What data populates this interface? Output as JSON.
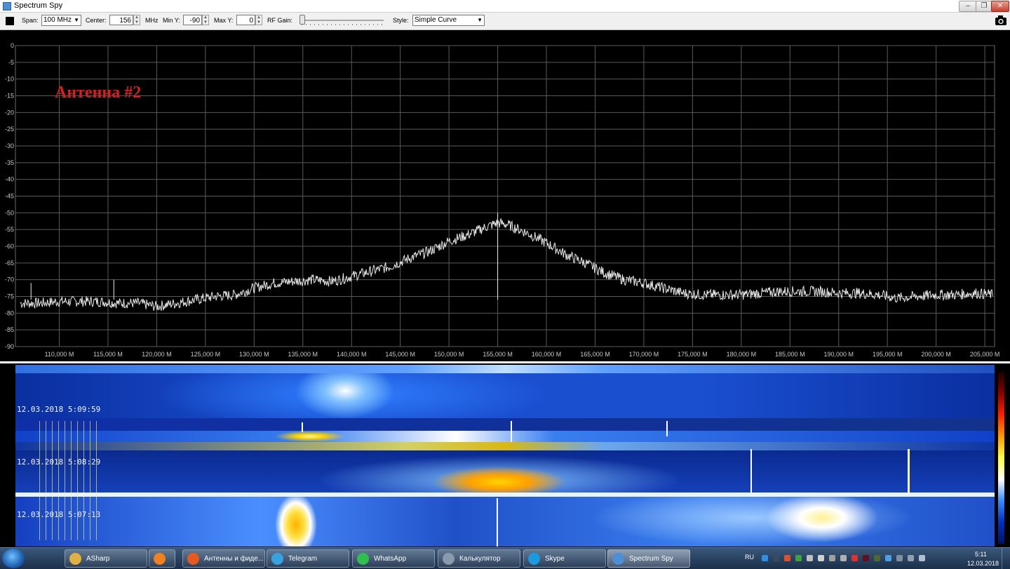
{
  "window": {
    "title": "Spectrum Spy",
    "buttons": [
      "–",
      "❐",
      "✕"
    ]
  },
  "toolbar": {
    "span_label": "Span:",
    "span_value": "100 MHz",
    "center_label": "Center:",
    "center_value": "156",
    "center_unit": "MHz",
    "miny_label": "Min Y:",
    "miny_value": "-90",
    "maxy_label": "Max Y:",
    "maxy_value": "0",
    "rfgain_label": "RF Gain:",
    "rfgain_level": 0.0,
    "style_label": "Style:",
    "style_value": "Simple Curve"
  },
  "chart_data": {
    "type": "line",
    "annotation": "Антенна #2",
    "ylim": [
      -90,
      0
    ],
    "xlim": [
      105.5,
      206
    ],
    "y_ticks": [
      "0",
      "-5",
      "-10",
      "-15",
      "-20",
      "-25",
      "-30",
      "-35",
      "-40",
      "-45",
      "-50",
      "-55",
      "-60",
      "-65",
      "-70",
      "-75",
      "-80",
      "-85",
      "-90"
    ],
    "x_ticks": [
      {
        "v": 110,
        "label": "110,000 M"
      },
      {
        "v": 115,
        "label": "115,000 M"
      },
      {
        "v": 120,
        "label": "120,000 M"
      },
      {
        "v": 125,
        "label": "125,000 M"
      },
      {
        "v": 130,
        "label": "130,000 M"
      },
      {
        "v": 135,
        "label": "135,000 M"
      },
      {
        "v": 140,
        "label": "140,000 M"
      },
      {
        "v": 145,
        "label": "145,000 M"
      },
      {
        "v": 150,
        "label": "150,000 M"
      },
      {
        "v": 155,
        "label": "155,000 M"
      },
      {
        "v": 160,
        "label": "160,000 M"
      },
      {
        "v": 165,
        "label": "165,000 M"
      },
      {
        "v": 170,
        "label": "170,000 M"
      },
      {
        "v": 175,
        "label": "175,000 M"
      },
      {
        "v": 180,
        "label": "180,000 M"
      },
      {
        "v": 185,
        "label": "185,000 M"
      },
      {
        "v": 190,
        "label": "190,000 M"
      },
      {
        "v": 195,
        "label": "195,000 M"
      },
      {
        "v": 200,
        "label": "200,000 M"
      },
      {
        "v": 205,
        "label": "205,000 M"
      }
    ],
    "series": [
      {
        "color": "#e8e8e8",
        "x": [
          106,
          108,
          110,
          112,
          114,
          116,
          118,
          120,
          122,
          124,
          126,
          128,
          130,
          132,
          134,
          136,
          138,
          140,
          142,
          144,
          146,
          148,
          150,
          152,
          154,
          155,
          156,
          158,
          160,
          162,
          164,
          166,
          168,
          170,
          172,
          174,
          176,
          178,
          180,
          182,
          184,
          186,
          188,
          190,
          192,
          194,
          196,
          198,
          200,
          202,
          204,
          205.8
        ],
        "y": [
          -77,
          -77,
          -76.5,
          -76.5,
          -76.5,
          -77,
          -77,
          -78,
          -77,
          -76,
          -75,
          -74.5,
          -72.5,
          -71,
          -70.5,
          -70,
          -70.5,
          -69,
          -67.5,
          -66,
          -63.5,
          -61.5,
          -58.5,
          -56.5,
          -54,
          -53,
          -53.5,
          -56,
          -59,
          -62.5,
          -65,
          -68,
          -70,
          -71,
          -72.5,
          -74,
          -74.5,
          -74.5,
          -74.5,
          -74,
          -73.5,
          -73.5,
          -73.5,
          -74,
          -74,
          -74.5,
          -75.5,
          -75,
          -74.5,
          -74.5,
          -74,
          -74.5
        ]
      }
    ]
  },
  "waterfall": {
    "timestamps": [
      "12.03.2018 5:09:59",
      "12.03.2018 5:08:29",
      "12.03.2018 5:07:13"
    ],
    "color_scale": [
      "#1a0000",
      "#8a0000",
      "#ff2000",
      "#ff9a00",
      "#ffff40",
      "#ffffff",
      "#3a8aff",
      "#0030c0",
      "#00106a"
    ]
  },
  "taskbar": {
    "quick_launch": [
      {
        "icon": "internet-explorer-icon",
        "color": "#2f8fe0"
      },
      {
        "icon": "folder-icon",
        "color": "#e0b040"
      },
      {
        "icon": "media-player-icon",
        "color": "#e07020"
      }
    ],
    "apps": [
      {
        "label": "ASharp",
        "icon": "folder-icon",
        "color": "#e0b040"
      },
      {
        "label": "",
        "icon": "media-icon",
        "color": "#f08020"
      },
      {
        "label": "Антенны и фиде...",
        "icon": "firefox-icon",
        "color": "#e65a20"
      },
      {
        "label": "Telegram",
        "icon": "telegram-icon",
        "color": "#36a3e0"
      },
      {
        "label": "WhatsApp",
        "icon": "whatsapp-icon",
        "color": "#2ebf4f"
      },
      {
        "label": "Калькулятор",
        "icon": "calculator-icon",
        "color": "#8a9aac"
      },
      {
        "label": "Skype",
        "icon": "skype-icon",
        "color": "#1a9be0"
      },
      {
        "label": "Spectrum Spy",
        "icon": "spectrum-spy-icon",
        "color": "#4c8fd6"
      }
    ],
    "language": "RU",
    "clock_time": "5:11",
    "clock_date": "12.03.2018"
  }
}
